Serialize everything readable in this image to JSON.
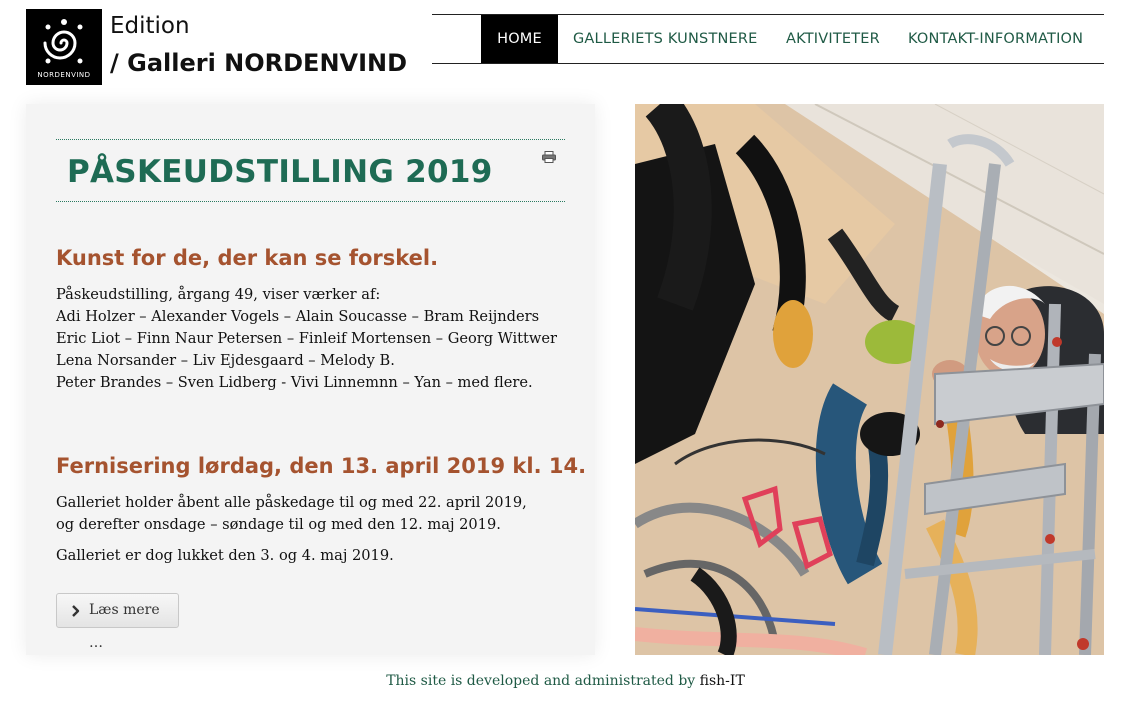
{
  "header": {
    "logo_label": "NORDENVIND",
    "brand_line1": "Edition",
    "brand_line2": "/ Galleri NORDENVIND"
  },
  "nav": {
    "items": [
      {
        "label": "HOME",
        "active": true
      },
      {
        "label": "GALLERIETS KUNSTNERE",
        "active": false
      },
      {
        "label": "AKTIVITETER",
        "active": false
      },
      {
        "label": "KONTAKT-INFORMATION",
        "active": false
      }
    ]
  },
  "article": {
    "title": "PÅSKEUDSTILLING 2019",
    "print_icon": "printer-icon",
    "subhead1": "Kunst for de, der kan se forskel.",
    "para1_lines": [
      "Påskeudstilling, årgang 49, viser værker af:",
      "Adi Holzer – Alexander Vogels – Alain Soucasse – Bram Reijnders",
      "Eric Liot – Finn Naur Petersen – Finleif Mortensen – Georg Wittwer",
      "Lena Norsander – Liv Ejdesgaard – Melody B.",
      "Peter Brandes – Sven Lidberg - Vivi Linnemnn – Yan – med flere."
    ],
    "subhead2": "Fernisering lørdag, den 13. april 2019 kl. 14.",
    "para2_lines": [
      "Galleriet holder åbent alle påskedage til og med 22. april 2019,",
      "og derefter onsdage – søndage til og med den 12. maj 2019."
    ],
    "para3": "Galleriet er dog lukket den 3. og 4. maj 2019.",
    "read_more": "Læs mere …"
  },
  "footer": {
    "text": "This site is developed and administrated by",
    "link": "fish-IT"
  },
  "colors": {
    "accent_green": "#1e6b54",
    "subhead_rust": "#a5532f",
    "nav_active_bg": "#000000"
  }
}
